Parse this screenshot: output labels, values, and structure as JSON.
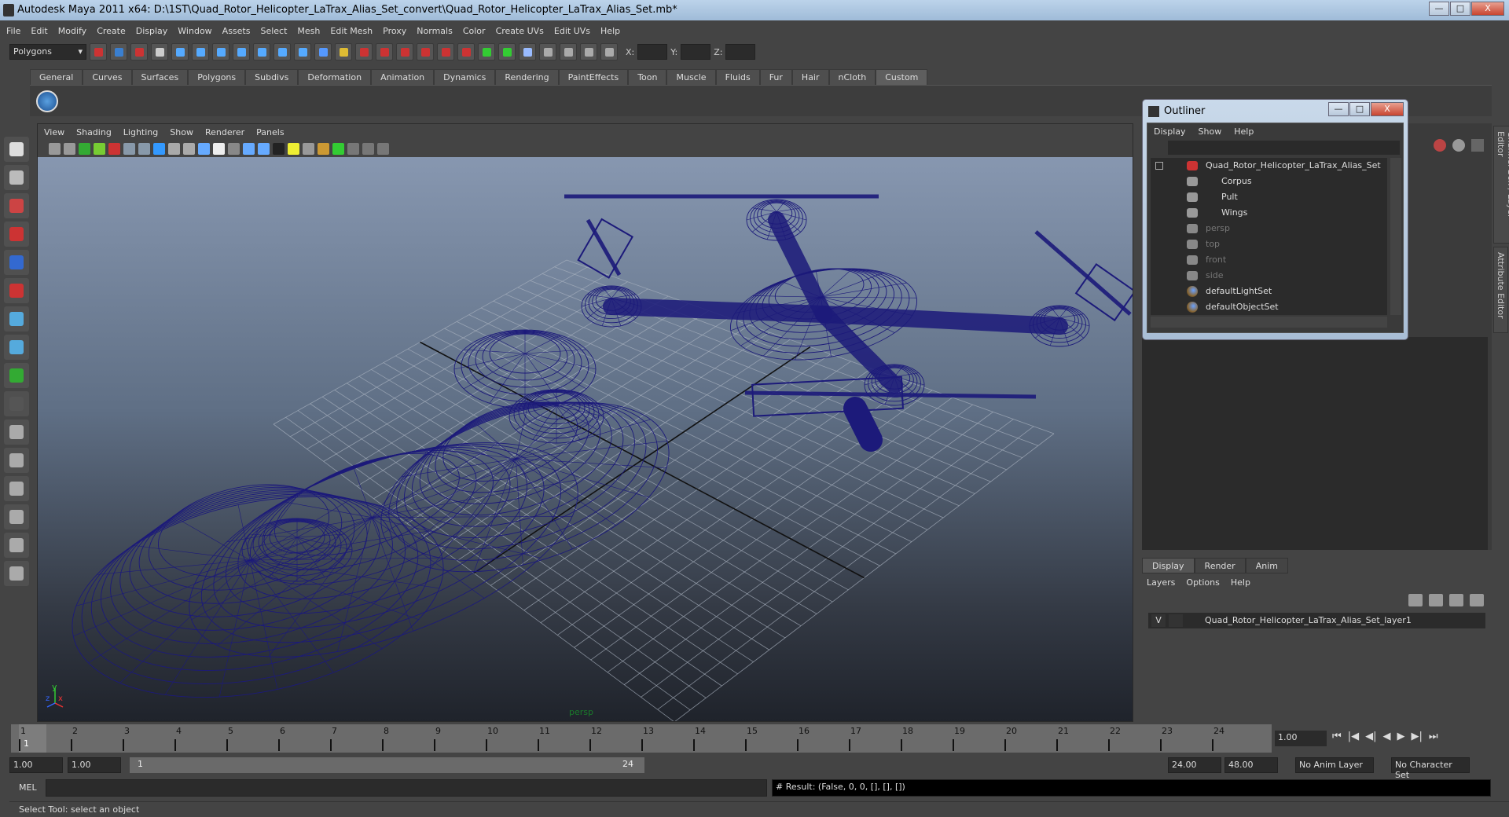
{
  "window": {
    "title": "Autodesk Maya 2011 x64: D:\\1ST\\Quad_Rotor_Helicopter_LaTrax_Alias_Set_convert\\Quad_Rotor_Helicopter_LaTrax_Alias_Set.mb*",
    "minimize": "—",
    "maximize": "□",
    "close": "X"
  },
  "menubar": [
    "File",
    "Edit",
    "Modify",
    "Create",
    "Display",
    "Window",
    "Assets",
    "Select",
    "Mesh",
    "Edit Mesh",
    "Proxy",
    "Normals",
    "Color",
    "Create UVs",
    "Edit UVs",
    "Help"
  ],
  "toolbar": {
    "mode": "Polygons",
    "x_label": "X:",
    "y_label": "Y:",
    "z_label": "Z:"
  },
  "shelf": {
    "tabs": [
      "General",
      "Curves",
      "Surfaces",
      "Polygons",
      "Subdivs",
      "Deformation",
      "Animation",
      "Dynamics",
      "Rendering",
      "PaintEffects",
      "Toon",
      "Muscle",
      "Fluids",
      "Fur",
      "Hair",
      "nCloth",
      "Custom"
    ],
    "active": "Custom"
  },
  "viewport": {
    "menus": [
      "View",
      "Shading",
      "Lighting",
      "Show",
      "Renderer",
      "Panels"
    ],
    "camera": "persp",
    "axis_y": "y",
    "axis_x": "x",
    "axis_z": "z",
    "wire_color": "#1c1a7a"
  },
  "outliner": {
    "title": "Outliner",
    "menus": [
      "Display",
      "Show",
      "Help"
    ],
    "items": [
      {
        "label": "Quad_Rotor_Helicopter_LaTrax_Alias_Set",
        "type": "group",
        "dim": false
      },
      {
        "label": "Corpus",
        "type": "mesh",
        "dim": false
      },
      {
        "label": "Pult",
        "type": "mesh",
        "dim": false
      },
      {
        "label": "Wings",
        "type": "mesh",
        "dim": false
      },
      {
        "label": "persp",
        "type": "camera",
        "dim": true
      },
      {
        "label": "top",
        "type": "camera",
        "dim": true
      },
      {
        "label": "front",
        "type": "camera",
        "dim": true
      },
      {
        "label": "side",
        "type": "camera",
        "dim": true
      },
      {
        "label": "defaultLightSet",
        "type": "set",
        "dim": false
      },
      {
        "label": "defaultObjectSet",
        "type": "set",
        "dim": false
      }
    ]
  },
  "side_tabs": [
    "Channel Box / Layer Editor",
    "Attribute Editor"
  ],
  "layer_editor": {
    "tabs": [
      "Display",
      "Render",
      "Anim"
    ],
    "active": "Display",
    "menus": [
      "Layers",
      "Options",
      "Help"
    ],
    "layers": [
      {
        "visible": "V",
        "name": "Quad_Rotor_Helicopter_LaTrax_Alias_Set_layer1"
      }
    ]
  },
  "timeline": {
    "ticks": [
      1,
      2,
      3,
      4,
      5,
      6,
      7,
      8,
      9,
      10,
      11,
      12,
      13,
      14,
      15,
      16,
      17,
      18,
      19,
      20,
      21,
      22,
      23,
      24
    ],
    "current_frame_label": "1",
    "current_time": "1.00"
  },
  "playback": [
    "⏮",
    "|◀",
    "◀|",
    "◀",
    "▶",
    "▶|",
    "⏭"
  ],
  "range": {
    "start_time": "1.00",
    "playback_start": "1.00",
    "slider_start": "1",
    "slider_end": "24",
    "playback_end": "24.00",
    "end_time": "48.00",
    "anim_layer": "No Anim Layer",
    "character_set": "No Character Set"
  },
  "command": {
    "language": "MEL",
    "input": "",
    "result": "# Result: (False, 0, 0, [], [], [])"
  },
  "help_line": "Select Tool: select an object"
}
